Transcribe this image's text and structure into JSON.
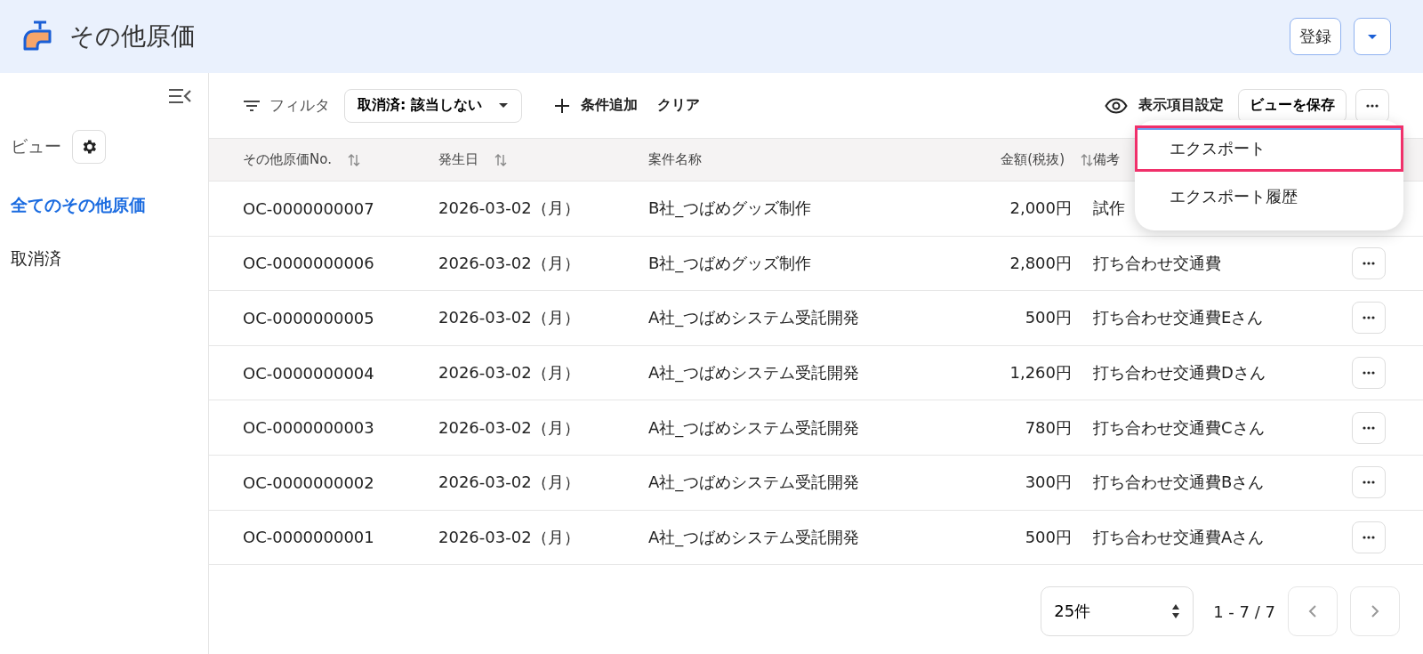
{
  "header": {
    "title": "その他原価",
    "register_button": "登録"
  },
  "sidebar": {
    "heading": "ビュー",
    "items": [
      {
        "label": "全てのその他原価",
        "selected": true
      },
      {
        "label": "取消済",
        "selected": false
      }
    ]
  },
  "toolbar": {
    "filter_label": "フィルタ",
    "filter_chip": "取消済: 該当しない",
    "add_condition": "条件追加",
    "clear": "クリア",
    "columns_setting": "表示項目設定",
    "save_view": "ビューを保存"
  },
  "table": {
    "columns": [
      {
        "label": "その他原価No.",
        "sortable": true
      },
      {
        "label": "発生日",
        "sortable": true
      },
      {
        "label": "案件名称",
        "sortable": false
      },
      {
        "label": "金額(税抜)",
        "sortable": true
      },
      {
        "label": "備考",
        "sortable": false
      }
    ],
    "rows": [
      {
        "cells": [
          "OC-0000000007",
          "2026-03-02（月）",
          "B社_つばめグッズ制作",
          "2,000円",
          "試作"
        ],
        "actions": false
      },
      {
        "cells": [
          "OC-0000000006",
          "2026-03-02（月）",
          "B社_つばめグッズ制作",
          "2,800円",
          "打ち合わせ交通費"
        ],
        "actions": true
      },
      {
        "cells": [
          "OC-0000000005",
          "2026-03-02（月）",
          "A社_つばめシステム受託開発",
          "500円",
          "打ち合わせ交通費Eさん"
        ],
        "actions": true
      },
      {
        "cells": [
          "OC-0000000004",
          "2026-03-02（月）",
          "A社_つばめシステム受託開発",
          "1,260円",
          "打ち合わせ交通費Dさん"
        ],
        "actions": true
      },
      {
        "cells": [
          "OC-0000000003",
          "2026-03-02（月）",
          "A社_つばめシステム受託開発",
          "780円",
          "打ち合わせ交通費Cさん"
        ],
        "actions": true
      },
      {
        "cells": [
          "OC-0000000002",
          "2026-03-02（月）",
          "A社_つばめシステム受託開発",
          "300円",
          "打ち合わせ交通費Bさん"
        ],
        "actions": true
      },
      {
        "cells": [
          "OC-0000000001",
          "2026-03-02（月）",
          "A社_つばめシステム受託開発",
          "500円",
          "打ち合わせ交通費Aさん"
        ],
        "actions": true
      }
    ]
  },
  "menu": {
    "items": [
      {
        "label": "エクスポート",
        "selected": true
      },
      {
        "label": "エクスポート履歴",
        "selected": false
      }
    ]
  },
  "pagination": {
    "page_size": "25件",
    "range": "1 - 7 / 7"
  }
}
